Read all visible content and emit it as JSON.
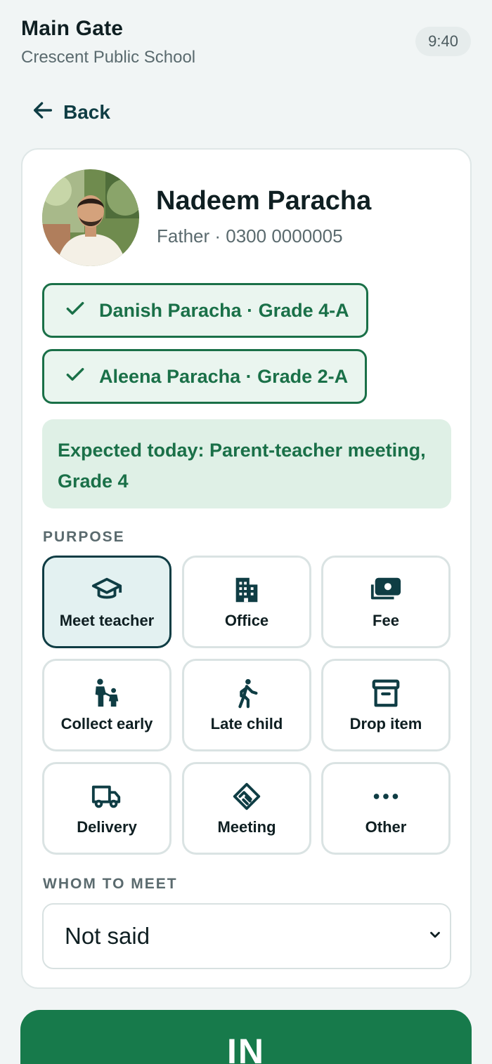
{
  "header": {
    "title": "Main Gate",
    "subtitle": "Crescent Public School",
    "time": "9:40"
  },
  "nav": {
    "back_label": "Back"
  },
  "visitor": {
    "name": "Nadeem Paracha",
    "meta": "Father · 0300 0000005",
    "children": [
      {
        "label": "Danish Paracha · Grade 4-A",
        "checked": true
      },
      {
        "label": "Aleena Paracha · Grade 2-A",
        "checked": true
      }
    ],
    "expected_note": "Expected today: Parent-teacher meeting, Grade 4"
  },
  "purpose": {
    "section_label": "PURPOSE",
    "selected": "Meet teacher",
    "options": [
      {
        "label": "Meet teacher",
        "icon": "graduation-cap-icon"
      },
      {
        "label": "Office",
        "icon": "building-icon"
      },
      {
        "label": "Fee",
        "icon": "money-icon"
      },
      {
        "label": "Collect early",
        "icon": "parent-child-icon"
      },
      {
        "label": "Late child",
        "icon": "walking-person-icon"
      },
      {
        "label": "Drop item",
        "icon": "archive-box-icon"
      },
      {
        "label": "Delivery",
        "icon": "truck-icon"
      },
      {
        "label": "Meeting",
        "icon": "handshake-icon"
      },
      {
        "label": "Other",
        "icon": "more-dots-icon"
      }
    ]
  },
  "whom_to_meet": {
    "section_label": "WHOM TO MEET",
    "selected_value": "Not said"
  },
  "action": {
    "in_label": "IN"
  },
  "colors": {
    "accent_green": "#177a4b",
    "chip_green": "#1a7048",
    "dark_teal": "#0f3d44",
    "page_bg": "#f1f5f5"
  }
}
